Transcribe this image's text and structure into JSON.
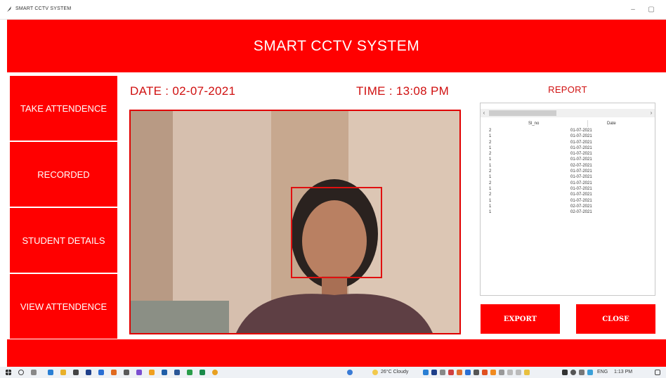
{
  "window": {
    "title": "SMART CCTV SYSTEM"
  },
  "app": {
    "heading": "SMART CCTV SYSTEM"
  },
  "sidebar": {
    "buttons": [
      "TAKE ATTENDENCE",
      "RECORDED",
      "STUDENT DETAILS",
      "VIEW ATTENDENCE"
    ]
  },
  "status": {
    "date": "DATE :  02-07-2021",
    "time": "TIME : 13:08 PM"
  },
  "report": {
    "title": "REPORT",
    "columns": [
      "Sl_no",
      "Date"
    ],
    "rows": [
      [
        "2",
        "01-07-2021"
      ],
      [
        "1",
        "01-07-2021"
      ],
      [
        "2",
        "01-07-2021"
      ],
      [
        "1",
        "01-07-2021"
      ],
      [
        "2",
        "01-07-2021"
      ],
      [
        "1",
        "01-07-2021"
      ],
      [
        "1",
        "02-07-2021"
      ],
      [
        "2",
        "01-07-2021"
      ],
      [
        "1",
        "01-07-2021"
      ],
      [
        "2",
        "01-07-2021"
      ],
      [
        "1",
        "01-07-2021"
      ],
      [
        "2",
        "01-07-2021"
      ],
      [
        "1",
        "01-07-2021"
      ],
      [
        "1",
        "02-07-2021"
      ],
      [
        "1",
        "02-07-2021"
      ]
    ]
  },
  "actions": {
    "export": "EXPORT",
    "close": "CLOSE"
  },
  "taskbar": {
    "weather": "26°C  Cloudy",
    "language": "ENG",
    "clock": "1:13 PM"
  },
  "colors": {
    "accent": "#ff0000",
    "text_red": "#d01010",
    "face_box": "#e01010"
  }
}
